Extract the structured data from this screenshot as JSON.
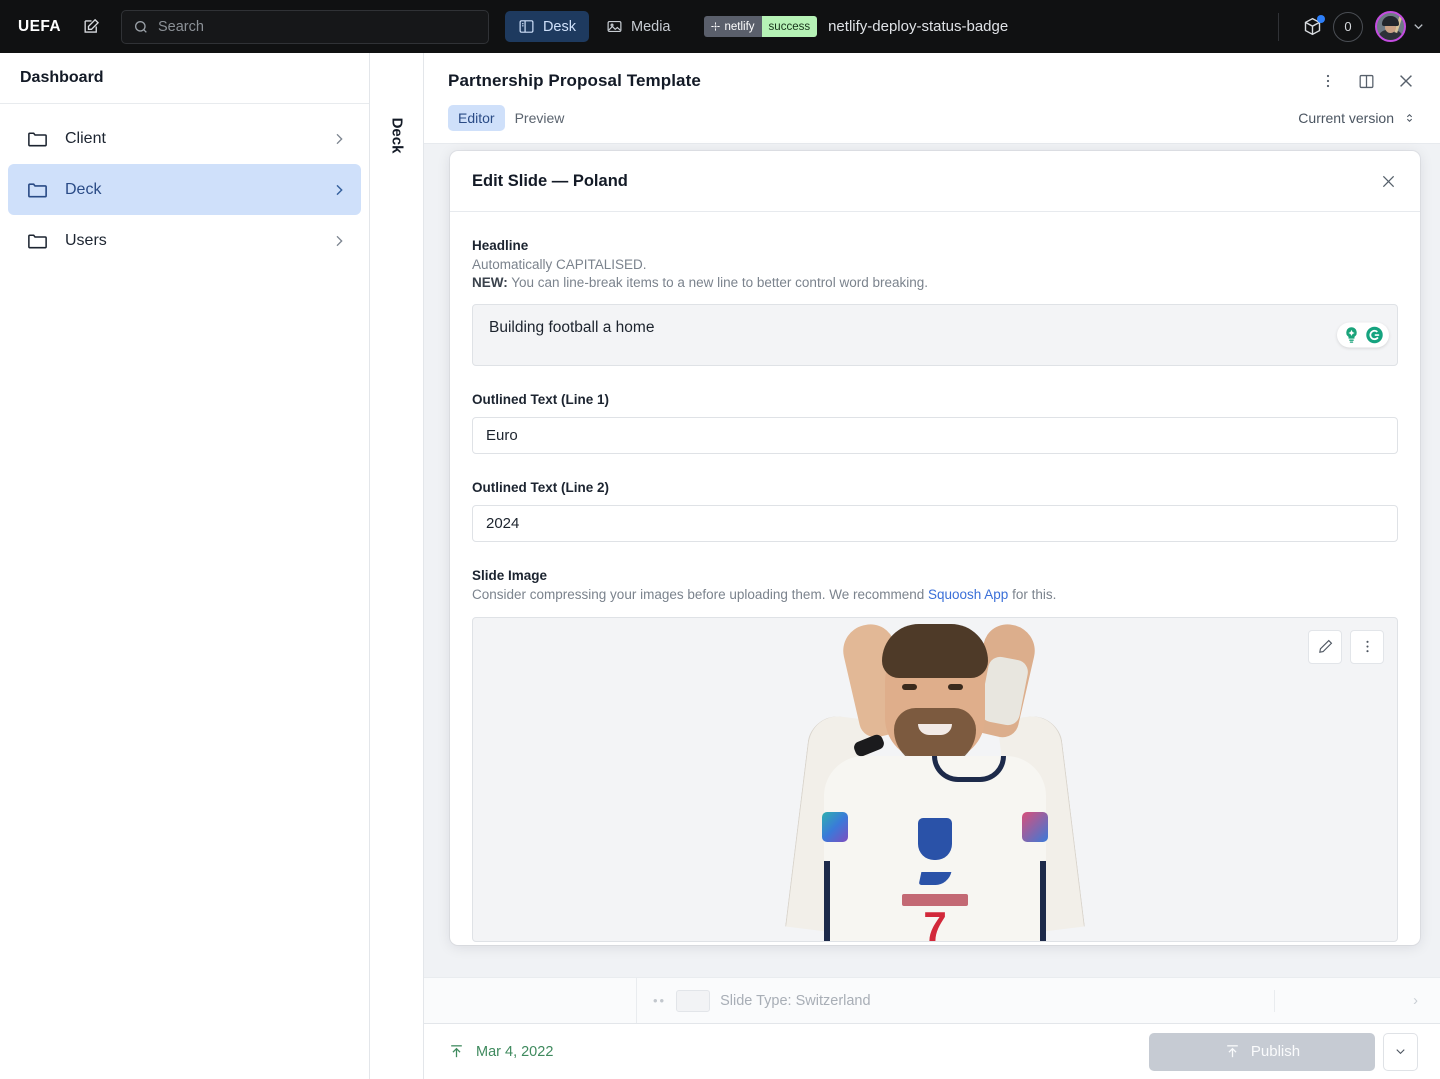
{
  "topbar": {
    "brand": "UEFA",
    "compose_icon": "compose-icon",
    "search": {
      "placeholder": "Search",
      "icon": "search-icon",
      "value": ""
    },
    "tabs": [
      {
        "label": "Desk",
        "icon": "desk-icon",
        "active": true
      },
      {
        "label": "Media",
        "icon": "media-image-icon",
        "active": false
      }
    ],
    "deploy": {
      "badge_left": "netlify",
      "badge_right": "success",
      "name": "netlify-deploy-status-badge",
      "badge_left_bg": "#5a5f6b",
      "badge_right_bg": "#b6f2b6"
    },
    "packages_icon": "package-icon",
    "notification_count": "0",
    "avatar": "user-avatar",
    "avatar_ring_color": "#c44ce0",
    "chevron": "chevron-down-icon"
  },
  "sidebar": {
    "title": "Dashboard",
    "items": [
      {
        "label": "Client",
        "icon": "folder-icon",
        "active": false
      },
      {
        "label": "Deck",
        "icon": "folder-icon",
        "active": true
      },
      {
        "label": "Users",
        "icon": "folder-icon",
        "active": false
      }
    ],
    "active_bg": "#cfe0fa"
  },
  "rail": {
    "label": "Deck"
  },
  "document": {
    "title": "Partnership Proposal Template",
    "tabs": [
      {
        "label": "Editor",
        "active": true
      },
      {
        "label": "Preview",
        "active": false
      }
    ],
    "version_label": "Current version",
    "header_icons": [
      "more-vertical-icon",
      "split-pane-icon",
      "close-icon"
    ]
  },
  "dialog": {
    "title": "Edit Slide — Poland",
    "close_icon": "close-icon",
    "fields": {
      "headline": {
        "label": "Headline",
        "desc_line1": "Automatically CAPITALISED.",
        "desc_new_prefix": "NEW:",
        "desc_line2": " You can line-break items to a new line to better control word breaking.",
        "value": "Building football a home",
        "assist_icons": [
          "grammarly-lightbulb-icon",
          "grammarly-logo-icon"
        ]
      },
      "outlined_line1": {
        "label": "Outlined Text (Line 1)",
        "value": "Euro"
      },
      "outlined_line2": {
        "label": "Outlined Text (Line 2)",
        "value": "2024"
      },
      "slide_image": {
        "label": "Slide Image",
        "desc_prefix": "Consider compressing your images before uploading them. We recommend ",
        "link_text": "Squoosh App",
        "desc_suffix": " for this.",
        "actions": [
          "edit-pencil-icon",
          "more-vertical-icon"
        ],
        "photo_alt": "footballer-celebrating",
        "photo_shirt_number": "7"
      }
    }
  },
  "background_row": {
    "slide_type_label": "Slide Type: Switzerland"
  },
  "footer": {
    "publish_date": "Mar 4, 2022",
    "publish_date_icon": "publish-up-icon",
    "publish_button": "Publish",
    "publish_button_icon": "publish-up-icon",
    "publish_caret_icon": "chevron-down-icon",
    "publish_accent": "#3f8a5e"
  }
}
